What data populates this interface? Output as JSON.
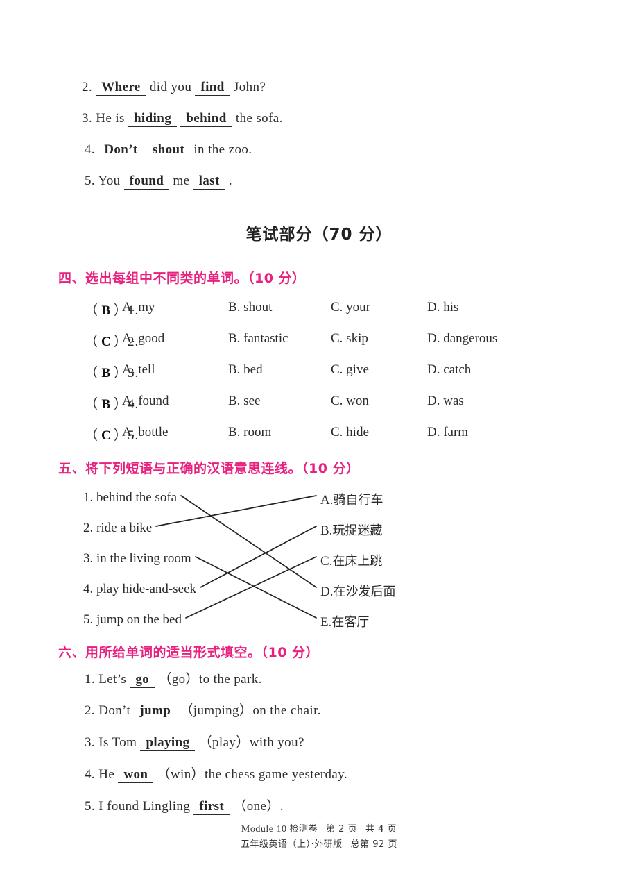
{
  "theme": {
    "heading_color": "#E8207E",
    "text_color": "#262626",
    "page_background": "#FFFFFF"
  },
  "top_section": {
    "items": [
      {
        "number": "2.",
        "parts": [
          {
            "type": "blank",
            "text": "Where"
          },
          {
            "type": "plain",
            "text": "did you"
          },
          {
            "type": "blank",
            "text": "find"
          },
          {
            "type": "plain",
            "text": "John?"
          }
        ]
      },
      {
        "number": "3.",
        "parts": [
          {
            "type": "plain",
            "text": "He is"
          },
          {
            "type": "blank",
            "text": "hiding"
          },
          {
            "type": "blank",
            "text": "behind"
          },
          {
            "type": "plain",
            "text": "the sofa."
          }
        ]
      },
      {
        "number": "4.",
        "parts": [
          {
            "type": "blank",
            "text": "Don’t"
          },
          {
            "type": "blank",
            "text": "shout"
          },
          {
            "type": "plain",
            "text": "in the zoo."
          }
        ]
      },
      {
        "number": "5.",
        "parts": [
          {
            "type": "plain",
            "text": "You"
          },
          {
            "type": "blank",
            "text": "found"
          },
          {
            "type": "plain",
            "text": "me"
          },
          {
            "type": "blank",
            "text": "last"
          },
          {
            "type": "plain",
            "text": "."
          }
        ]
      }
    ]
  },
  "part_title": "笔试部分（70 分）",
  "section_four": {
    "heading": "四、选出每组中不同类的单词。（10 分）",
    "rows": [
      {
        "answer": "B",
        "number": "1.",
        "a": "A. my",
        "b": "B. shout",
        "c": "C. your",
        "d": "D. his"
      },
      {
        "answer": "C",
        "number": "2.",
        "a": "A. good",
        "b": "B. fantastic",
        "c": "C. skip",
        "d": "D. dangerous"
      },
      {
        "answer": "B",
        "number": "3.",
        "a": "A. tell",
        "b": "B. bed",
        "c": "C. give",
        "d": "D. catch"
      },
      {
        "answer": "B",
        "number": "4.",
        "a": "A. found",
        "b": "B. see",
        "c": "C. won",
        "d": "D. was"
      },
      {
        "answer": "C",
        "number": "5.",
        "a": "A. bottle",
        "b": "B. room",
        "c": "C. hide",
        "d": "D. farm"
      }
    ]
  },
  "section_five": {
    "heading": "五、将下列短语与正确的汉语意思连线。（10 分）",
    "left_items": [
      {
        "label": "1. behind the sofa"
      },
      {
        "label": "2. ride a bike"
      },
      {
        "label": "3. in the living room"
      },
      {
        "label": "4. play hide-and-seek"
      },
      {
        "label": "5. jump on the bed"
      }
    ],
    "right_items": [
      {
        "letter": "A.",
        "label": "骑自行车"
      },
      {
        "letter": "B.",
        "label": "玩捉迷藏"
      },
      {
        "letter": "C.",
        "label": "在床上跳"
      },
      {
        "letter": "D.",
        "label": "在沙发后面"
      },
      {
        "letter": "E.",
        "label": "在客厅"
      }
    ],
    "connections": [
      {
        "from": 1,
        "to": "D"
      },
      {
        "from": 2,
        "to": "A"
      },
      {
        "from": 3,
        "to": "E"
      },
      {
        "from": 4,
        "to": "B"
      },
      {
        "from": 5,
        "to": "C"
      }
    ]
  },
  "section_six": {
    "heading": "六、用所给单词的适当形式填空。（10 分）",
    "items": [
      {
        "number": "1.",
        "parts": [
          {
            "type": "plain",
            "text": "Let’s"
          },
          {
            "type": "blank",
            "text": "go"
          },
          {
            "type": "plain",
            "text": "（go）to the park."
          }
        ]
      },
      {
        "number": "2.",
        "parts": [
          {
            "type": "plain",
            "text": "Don’t"
          },
          {
            "type": "blank",
            "text": "jump"
          },
          {
            "type": "plain",
            "text": "（jumping）on the chair."
          }
        ]
      },
      {
        "number": "3.",
        "parts": [
          {
            "type": "plain",
            "text": "Is Tom"
          },
          {
            "type": "blank",
            "text": "playing"
          },
          {
            "type": "plain",
            "text": "（play）with you?"
          }
        ]
      },
      {
        "number": "4.",
        "parts": [
          {
            "type": "plain",
            "text": "He"
          },
          {
            "type": "blank",
            "text": "won"
          },
          {
            "type": "plain",
            "text": "（win）the chess game yesterday."
          }
        ]
      },
      {
        "number": "5.",
        "parts": [
          {
            "type": "plain",
            "text": "I found Lingling"
          },
          {
            "type": "blank",
            "text": "first"
          },
          {
            "type": "plain",
            "text": "（one）."
          }
        ]
      }
    ]
  },
  "footer": {
    "line1_module": "Module 10",
    "line1_cn": "检测卷",
    "line1_page": "第 2 页",
    "line1_total": "共 4 页",
    "line2_grade": "五年级英语（上）·外研版",
    "line2_total": "总第 92 页"
  }
}
